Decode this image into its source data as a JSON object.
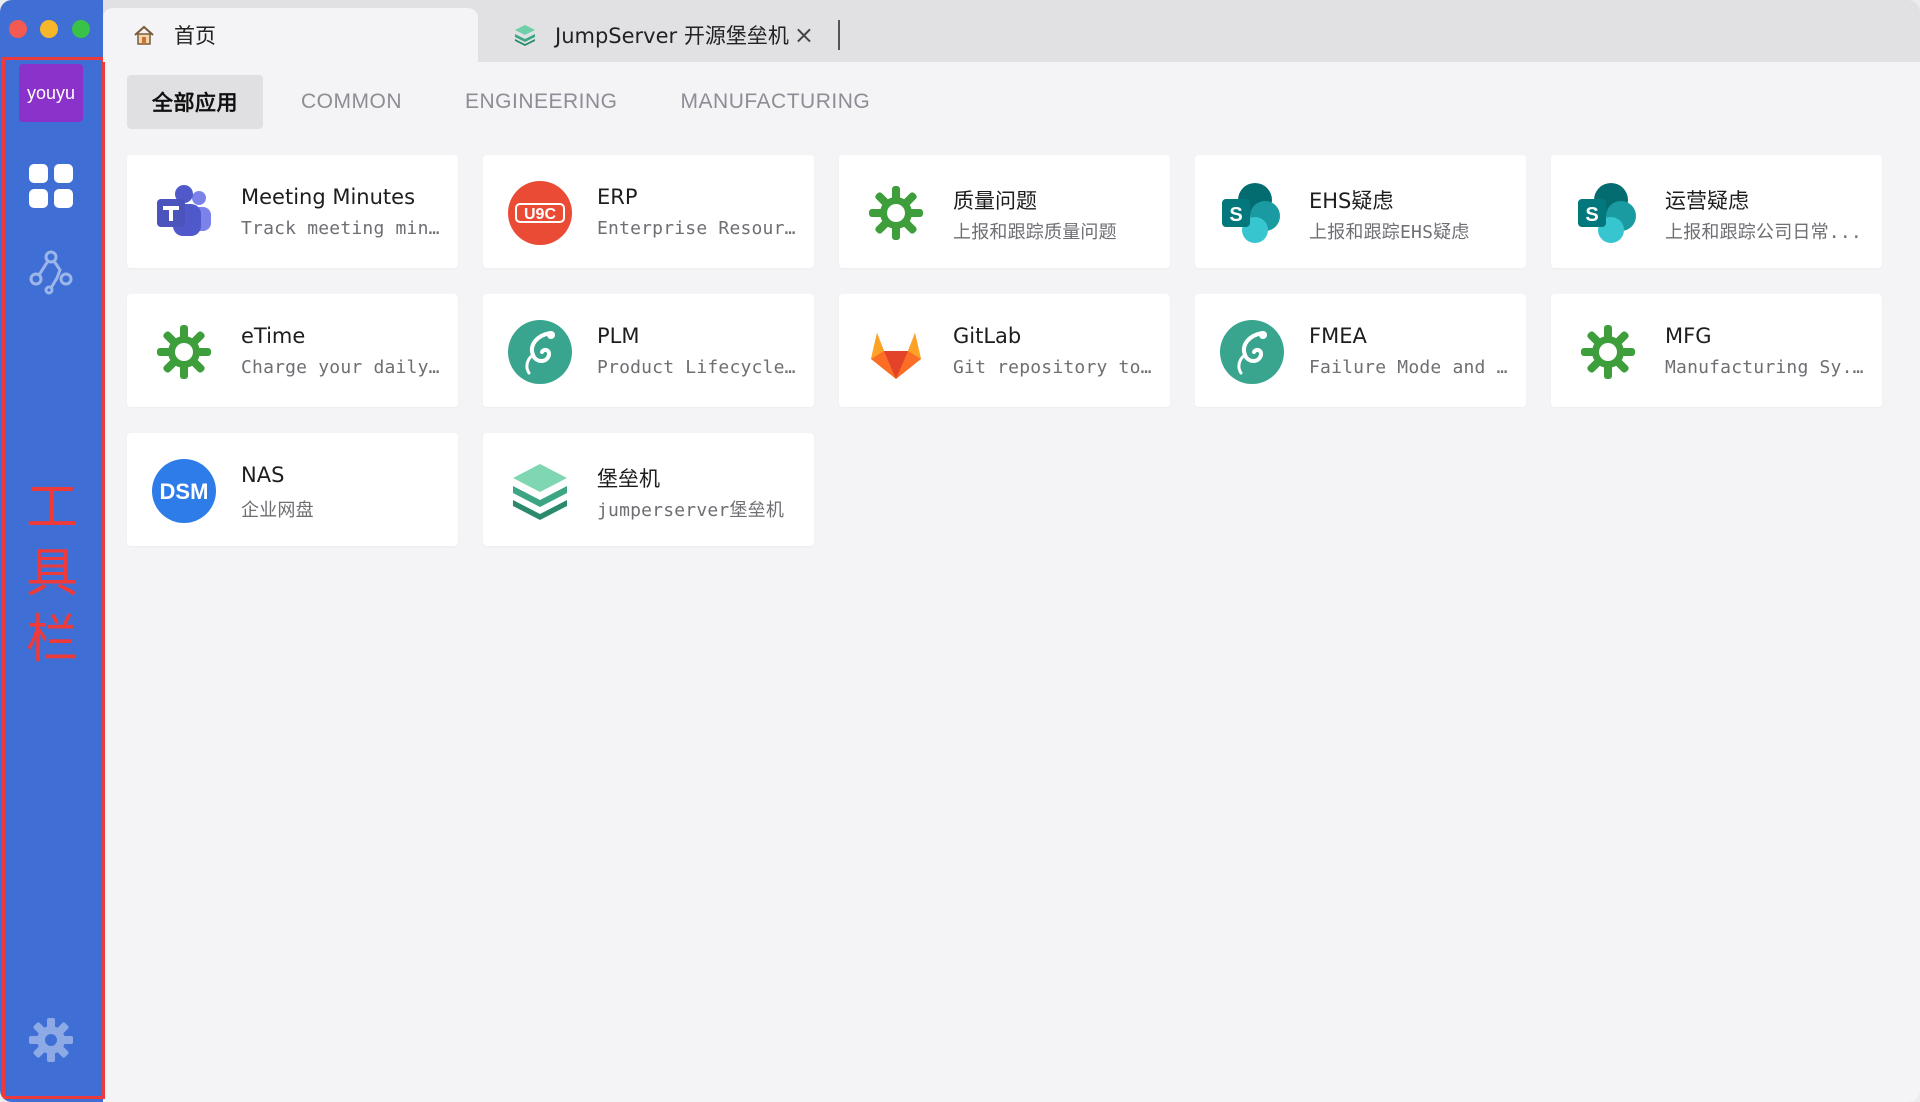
{
  "window": {
    "colors": {
      "sidebar": "#3f6fd4",
      "highlight": "#ee3a3a",
      "avatar": "#8a32c9"
    }
  },
  "sidebar": {
    "user": "youyu",
    "icons": [
      "apps-grid-icon",
      "workflow-icon",
      "settings-gear-icon"
    ],
    "annotation": "工具栏"
  },
  "tabs": [
    {
      "label": "首页",
      "icon": "home-icon"
    },
    {
      "label": "JumpServer 开源堡垒机",
      "icon": "jumpserver-icon",
      "closable": true,
      "close_glyph": "×"
    }
  ],
  "categories": [
    {
      "label": "全部应用",
      "active": true
    },
    {
      "label": "COMMON",
      "active": false
    },
    {
      "label": "ENGINEERING",
      "active": false
    },
    {
      "label": "MANUFACTURING",
      "active": false
    }
  ],
  "apps": [
    {
      "title": "Meeting Minutes",
      "desc": "Track meeting min...",
      "icon": "teams-icon"
    },
    {
      "title": "ERP",
      "desc": "Enterprise Resour...",
      "icon": "u9c-icon",
      "icon_text": "U9C"
    },
    {
      "title": "质量问题",
      "desc": "上报和跟踪质量问题",
      "icon": "green-gear-icon"
    },
    {
      "title": "EHS疑虑",
      "desc": "上报和跟踪EHS疑虑",
      "icon": "sharepoint-icon",
      "icon_text": "S"
    },
    {
      "title": "运营疑虑",
      "desc": "上报和跟踪公司日常...",
      "icon": "sharepoint-icon",
      "icon_text": "S"
    },
    {
      "title": "eTime",
      "desc": "Charge your daily ...",
      "icon": "green-gear-icon"
    },
    {
      "title": "PLM",
      "desc": "Product Lifecycle ...",
      "icon": "teal-lizard-icon"
    },
    {
      "title": "GitLab",
      "desc": "Git repository to s...",
      "icon": "gitlab-icon"
    },
    {
      "title": "FMEA",
      "desc": "Failure Mode and ...",
      "icon": "teal-lizard-icon"
    },
    {
      "title": "MFG",
      "desc": "Manufacturing Sy...",
      "icon": "green-gear-icon"
    },
    {
      "title": "NAS",
      "desc": "企业网盘",
      "icon": "dsm-icon",
      "icon_text": "DSM"
    },
    {
      "title": "堡垒机",
      "desc": "jumperserver堡垒机",
      "icon": "jumpserver-icon"
    }
  ]
}
